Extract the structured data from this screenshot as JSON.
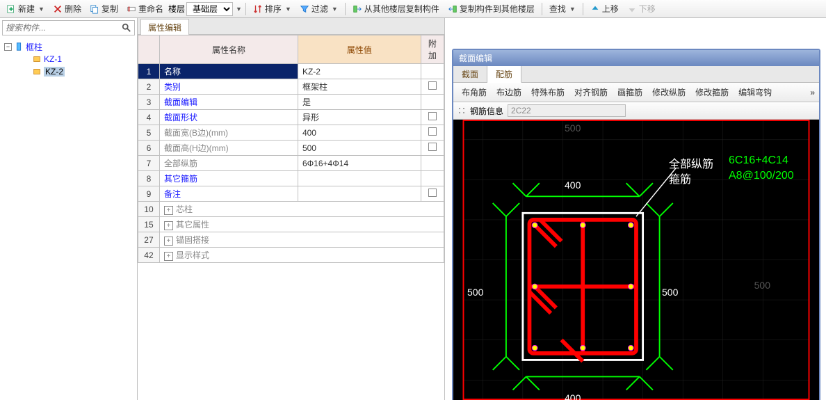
{
  "toolbar": {
    "new": "新建",
    "delete": "删除",
    "copy": "复制",
    "rename": "重命名",
    "floor_label": "楼层",
    "floor_value": "基础层",
    "sort": "排序",
    "filter": "过滤",
    "copy_from": "从其他楼层复制构件",
    "copy_to": "复制构件到其他楼层",
    "find": "查找",
    "up": "上移",
    "down": "下移"
  },
  "search": {
    "placeholder": "搜索构件..."
  },
  "tree": {
    "root": "框柱",
    "items": [
      "KZ-1",
      "KZ-2"
    ],
    "selected": "KZ-2"
  },
  "prop": {
    "tab": "属性编辑",
    "headers": {
      "name": "属性名称",
      "value": "属性值",
      "extra": "附加"
    },
    "rows": [
      {
        "n": "1",
        "name": "名称",
        "value": "KZ-2",
        "sel": true,
        "chk": false,
        "gray": false
      },
      {
        "n": "2",
        "name": "类别",
        "value": "框架柱",
        "chk": true,
        "gray": false
      },
      {
        "n": "3",
        "name": "截面编辑",
        "value": "是",
        "chk": false,
        "gray": false
      },
      {
        "n": "4",
        "name": "截面形状",
        "value": "异形",
        "chk": true,
        "gray": false
      },
      {
        "n": "5",
        "name": "截面宽(B边)(mm)",
        "value": "400",
        "chk": true,
        "gray": true
      },
      {
        "n": "6",
        "name": "截面高(H边)(mm)",
        "value": "500",
        "chk": true,
        "gray": true
      },
      {
        "n": "7",
        "name": "全部纵筋",
        "value": "6Φ16+4Φ14",
        "chk": false,
        "gray": true
      },
      {
        "n": "8",
        "name": "其它箍筋",
        "value": "",
        "chk": false,
        "gray": false
      },
      {
        "n": "9",
        "name": "备注",
        "value": "",
        "chk": true,
        "gray": false
      }
    ],
    "groups": [
      {
        "n": "10",
        "name": "芯柱"
      },
      {
        "n": "15",
        "name": "其它属性"
      },
      {
        "n": "27",
        "name": "锚固搭接"
      },
      {
        "n": "42",
        "name": "显示样式"
      }
    ]
  },
  "section": {
    "title": "截面编辑",
    "tabs": {
      "section": "截面",
      "rebar": "配筋"
    },
    "toolbar": [
      "布角筋",
      "布边筋",
      "特殊布筋",
      "对齐钢筋",
      "画箍筋",
      "修改纵筋",
      "修改箍筋",
      "编辑弯钩"
    ],
    "rebar_label": "钢筋信息",
    "rebar_value": "2C22",
    "labels": {
      "all_rebar": "全部纵筋",
      "all_rebar_val": "6C16+4C14",
      "stirrup": "箍筋",
      "stirrup_val": "A8@100/200"
    },
    "dims": {
      "top": "400",
      "bottom": "400",
      "left": "500",
      "right": "500",
      "grid": "500"
    }
  },
  "chart_data": {
    "type": "diagram",
    "description": "Column cross-section 400×500 mm with rebar layout and stirrups",
    "width_mm": 400,
    "height_mm": 500,
    "longitudinal_rebar": "6C16+4C14",
    "stirrup": "A8@100/200"
  }
}
